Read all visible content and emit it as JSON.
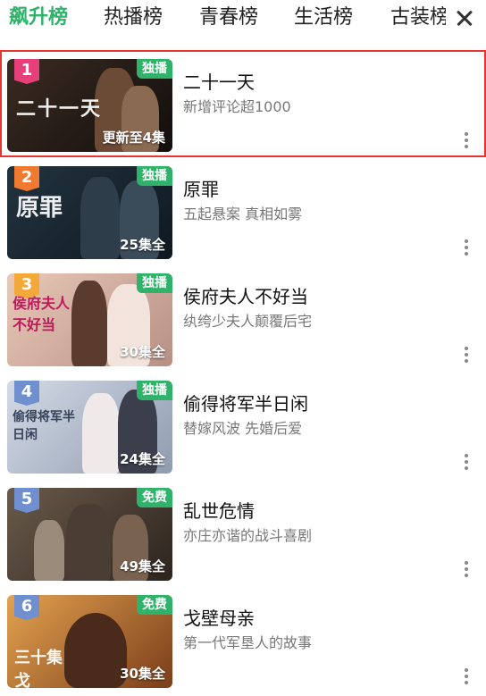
{
  "tabs": [
    {
      "label": "飙升榜",
      "active": true
    },
    {
      "label": "热播榜",
      "active": false
    },
    {
      "label": "青春榜",
      "active": false
    },
    {
      "label": "生活榜",
      "active": false
    },
    {
      "label": "古装榜",
      "active": false
    }
  ],
  "close_icon": "close-icon",
  "items": [
    {
      "rank": "1",
      "badge": "独播",
      "episodes": "更新至4集",
      "poster_title": "二十一天",
      "title": "二十一天",
      "subtitle": "新增评论超1000",
      "rank_color": "#e5407a",
      "bg": "#2a1f1a"
    },
    {
      "rank": "2",
      "badge": "独播",
      "episodes": "25集全",
      "poster_title": "原罪",
      "title": "原罪",
      "subtitle": "五起悬案 真相如雾",
      "rank_color": "#f07a32",
      "bg": "#1c2a34"
    },
    {
      "rank": "3",
      "badge": "独播",
      "episodes": "30集全",
      "poster_title": "侯府夫人不好当",
      "title": "侯府夫人不好当",
      "subtitle": "纨绔少夫人颠覆后宅",
      "rank_color": "#f3a93a",
      "bg": "#d9b7a6"
    },
    {
      "rank": "4",
      "badge": "独播",
      "episodes": "24集全",
      "poster_title": "偷得将军半日闲",
      "title": "偷得将军半日闲",
      "subtitle": "替嫁风波 先婚后爱",
      "rank_color": "#6f8fcf",
      "bg": "#b9c2d2"
    },
    {
      "rank": "5",
      "badge": "免费",
      "episodes": "49集全",
      "poster_title": "",
      "title": "乱世危情",
      "subtitle": "亦庄亦谐的战斗喜剧",
      "rank_color": "#6f8fcf",
      "bg": "#5b4a3c"
    },
    {
      "rank": "6",
      "badge": "免费",
      "episodes": "30集全",
      "poster_title": "三十集 戈",
      "title": "戈壁母亲",
      "subtitle": "第一代军垦人的故事",
      "rank_color": "#6f8fcf",
      "bg": "#d38a3c"
    }
  ]
}
